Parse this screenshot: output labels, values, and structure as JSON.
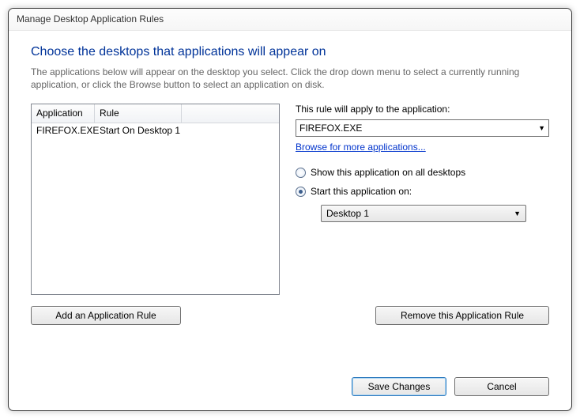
{
  "window": {
    "title": "Manage Desktop Application Rules"
  },
  "heading": "Choose the desktops that applications will appear on",
  "subtext": "The applications below will appear on the desktop you select. Click the drop down menu to select a currently running application, or click the Browse button to select an application on disk.",
  "table": {
    "headers": {
      "application": "Application",
      "rule": "Rule"
    },
    "rows": [
      {
        "application": "FIREFOX.EXE",
        "rule": "Start On Desktop 1"
      }
    ]
  },
  "right": {
    "applyLabel": "This rule will apply to the application:",
    "appSelected": "FIREFOX.EXE",
    "browseLink": "Browse for more applications...",
    "radioAll": "Show this application on all desktops",
    "radioStart": "Start this application on:",
    "desktopSelected": "Desktop 1"
  },
  "buttons": {
    "add": "Add an Application Rule",
    "remove": "Remove this Application Rule",
    "save": "Save Changes",
    "cancel": "Cancel"
  }
}
